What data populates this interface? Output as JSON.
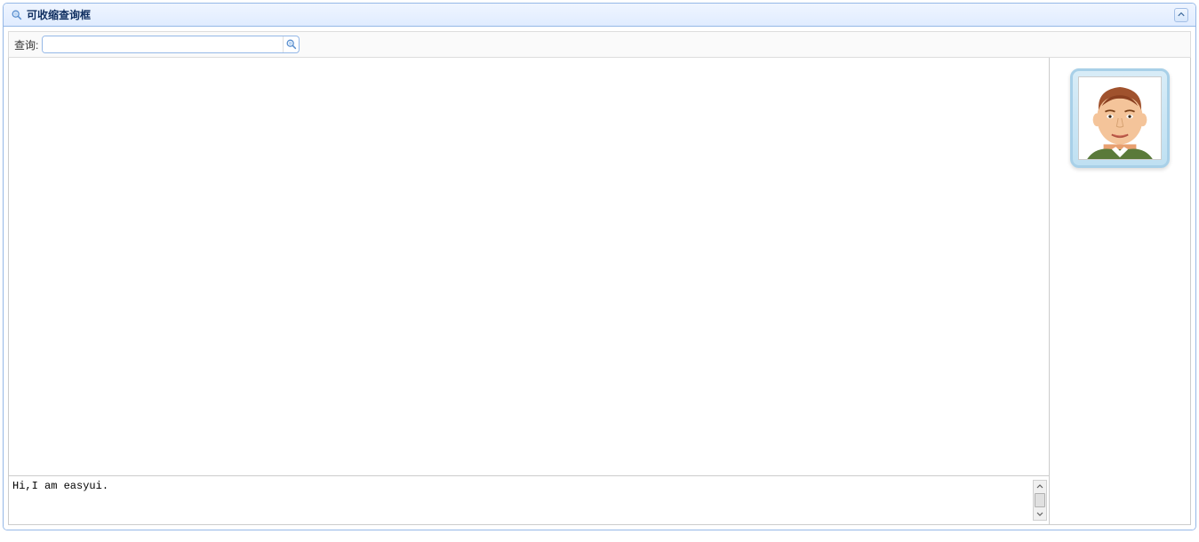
{
  "panel": {
    "title": "可收缩查询框"
  },
  "toolbar": {
    "search_label": "查询:",
    "search_value": ""
  },
  "south": {
    "text": "Hi,I am easyui."
  },
  "colors": {
    "border_primary": "#95b8e7",
    "title_color": "#0e2d5f",
    "header_bg_top": "#eff5ff",
    "header_bg_bottom": "#e0ecff"
  }
}
